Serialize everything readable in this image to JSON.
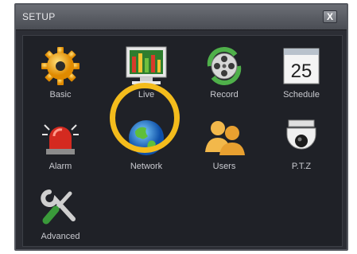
{
  "window": {
    "title": "SETUP",
    "close_glyph": "X"
  },
  "menu": {
    "items": [
      {
        "id": "basic",
        "label": "Basic",
        "icon": "gear-icon"
      },
      {
        "id": "live",
        "label": "Live",
        "icon": "monitor-equalizer-icon"
      },
      {
        "id": "record",
        "label": "Record",
        "icon": "film-reel-icon"
      },
      {
        "id": "schedule",
        "label": "Schedule",
        "icon": "calendar-icon",
        "icon_text": "25"
      },
      {
        "id": "alarm",
        "label": "Alarm",
        "icon": "alarm-siren-icon"
      },
      {
        "id": "network",
        "label": "Network",
        "icon": "globe-icon"
      },
      {
        "id": "users",
        "label": "Users",
        "icon": "users-icon"
      },
      {
        "id": "ptz",
        "label": "P.T.Z",
        "icon": "dome-camera-icon"
      },
      {
        "id": "advanced",
        "label": "Advanced",
        "icon": "tools-icon"
      }
    ],
    "highlighted": "network",
    "colors": {
      "highlight": "#f4bc1c",
      "label": "#c9cad0",
      "background": "#1f2127"
    }
  }
}
